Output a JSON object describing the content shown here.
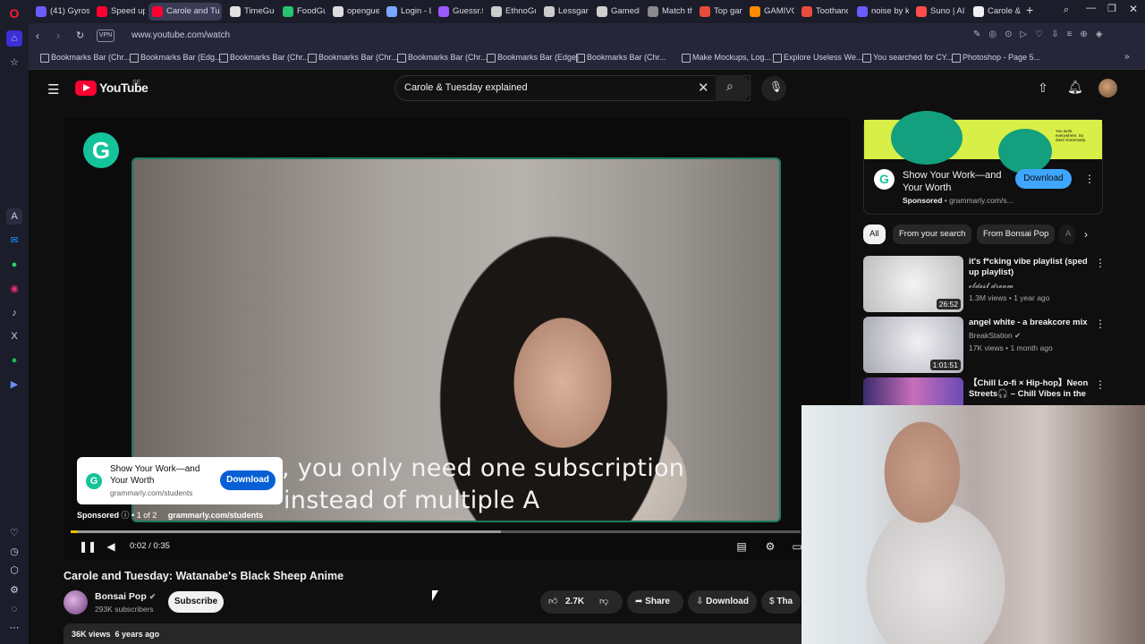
{
  "browser": {
    "tabs": [
      {
        "label": "(41) Gyros",
        "color": "#6b5cff"
      },
      {
        "label": "Speed up",
        "color": "#ff0033"
      },
      {
        "label": "Carole and Tu",
        "color": "#ff0033",
        "active": true
      },
      {
        "label": "TimeGues",
        "color": "#e0e0e0"
      },
      {
        "label": "FoodGues",
        "color": "#28c36f"
      },
      {
        "label": "opengues",
        "color": "#dddddd"
      },
      {
        "label": "Login - Lo",
        "color": "#7aa7ff"
      },
      {
        "label": "Guessr.tv",
        "color": "#9b59ff"
      },
      {
        "label": "EthnoGues",
        "color": "#cccccc"
      },
      {
        "label": "Lessgames",
        "color": "#cccccc"
      },
      {
        "label": "Gamedle",
        "color": "#d0d0d0"
      },
      {
        "label": "Match the",
        "color": "#8a8a8a"
      },
      {
        "label": "Top game",
        "color": "#e74c3c"
      },
      {
        "label": "GAMIVO |",
        "color": "#ff8c00"
      },
      {
        "label": "Toothand",
        "color": "#e74c3c"
      },
      {
        "label": "noise by k",
        "color": "#6b5cff"
      },
      {
        "label": "Suno | AI M",
        "color": "#ff4d4d"
      },
      {
        "label": "Carole & T",
        "color": "#f1f1f1"
      }
    ],
    "new_tab": "+",
    "vpn": "VPN",
    "url": "www.youtube.com/watch",
    "bookmarks": [
      "Bookmarks Bar (Chr...",
      "Bookmarks Bar (Edg...",
      "Bookmarks Bar (Chr...",
      "Bookmarks Bar (Chr...",
      "Bookmarks Bar (Chr...",
      "Bookmarks Bar (Edge)",
      "Bookmarks Bar (Chr...",
      "Make Mockups, Log...",
      "Explore Useless We...",
      "You searched for CY...",
      "Photoshop - Page 5..."
    ]
  },
  "youtube": {
    "logo_text": "YouTube",
    "region": "SE",
    "search_value": "Carole & Tuesday explained"
  },
  "player": {
    "caption_line1": ", you only need one subscription",
    "caption_line2": "instead of multiple A",
    "ad_title": "Show Your Work—and Your Worth",
    "ad_domain": "grammarly.com/students",
    "ad_download": "Download",
    "sponsored_label": "Sponsored",
    "ad_count": "1 of 2",
    "ad_url": "grammarly.com/students",
    "time": "0:02 / 0:35",
    "progress": 0.01,
    "buffered": 0.59,
    "grammarly_letter": "G"
  },
  "video": {
    "title": "Carole and Tuesday: Watanabe's Black Sheep Anime",
    "channel": "Bonsai Pop",
    "subscribers": "293K subscribers",
    "subscribe_label": "Subscribe",
    "likes": "2.7K",
    "share_label": "Share",
    "download_label": "Download",
    "thanks_label": "Tha",
    "views": "36K views",
    "age": "6 years ago"
  },
  "sidebar": {
    "ad": {
      "banner_text": "You work everywhere. So does Grammarly.",
      "title": "Show Your Work—and Your Worth",
      "sponsored": "Sponsored",
      "domain": "grammarly.com/s...",
      "download": "Download"
    },
    "chips": [
      "All",
      "From your search",
      "From Bonsai Pop",
      "A"
    ],
    "videos": [
      {
        "title": "it's f*cking vibe playlist (sped up playlist)",
        "channel": "𝓸𝓵𝓭𝓮𝓼𝓽 𝓭𝓻𝓮𝓪𝓶",
        "meta": "1.3M views • 1 year ago",
        "duration": "26:52"
      },
      {
        "title": "angel white - a breakcore mix",
        "channel": "BreakStation",
        "meta": "17K views • 1 month ago",
        "duration": "1:01:51"
      },
      {
        "title": "【Chill Lo-fi × Hip-hop】Neon Streets🎧 – Chill Vibes in the ...",
        "channel": "",
        "meta": "",
        "duration": ""
      }
    ]
  }
}
